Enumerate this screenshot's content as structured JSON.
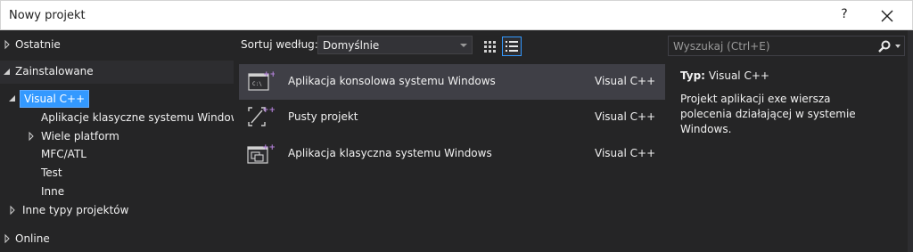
{
  "window": {
    "title": "Nowy projekt",
    "help_label": "?",
    "close_icon": "close-icon"
  },
  "tree": {
    "items": [
      {
        "label": "Ostatnie",
        "expander": "collapsed"
      },
      {
        "label": "Zainstalowane",
        "expander": "expanded"
      },
      {
        "label": "Visual C++",
        "expander": "expanded",
        "selected": true
      },
      {
        "label": "Aplikacje klasyczne systemu Windows"
      },
      {
        "label": "Wiele platform",
        "expander": "collapsed"
      },
      {
        "label": "MFC/ATL"
      },
      {
        "label": "Test"
      },
      {
        "label": "Inne"
      },
      {
        "label": "Inne typy projektów",
        "expander": "collapsed"
      },
      {
        "label": "Online",
        "expander": "collapsed"
      }
    ]
  },
  "toolbar": {
    "sort_label": "Sortuj według:",
    "sort_value": "Domyślnie",
    "grid_view_icon": "grid-view-icon",
    "list_view_icon": "list-view-icon"
  },
  "templates": [
    {
      "name": "Aplikacja konsolowa systemu Windows",
      "language": "Visual C++",
      "icon": "console-app-icon",
      "selected": true
    },
    {
      "name": "Pusty projekt",
      "language": "Visual C++",
      "icon": "empty-project-icon"
    },
    {
      "name": "Aplikacja klasyczna systemu Windows",
      "language": "Visual C++",
      "icon": "desktop-app-icon"
    }
  ],
  "search": {
    "placeholder": "Wyszukaj (Ctrl+E)",
    "icon": "search-icon"
  },
  "details": {
    "type_label": "Typ:",
    "type_value": "Visual C++",
    "description": "Projekt aplikacji exe wiersza polecenia działającej w systemie Windows."
  },
  "colors": {
    "selection": "#3399ff",
    "background": "#252526",
    "accent_badge": "#b180d7"
  }
}
